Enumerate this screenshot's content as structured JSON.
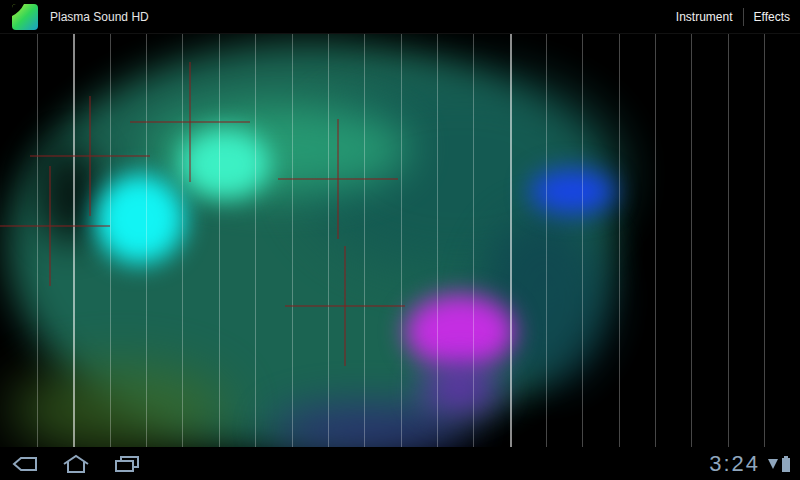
{
  "app": {
    "title": "Plasma Sound HD"
  },
  "actions": [
    {
      "label": "Instrument"
    },
    {
      "label": "Effects"
    }
  ],
  "note_lines": [
    {
      "active": false
    },
    {
      "active": true
    },
    {
      "active": false
    },
    {
      "active": false
    },
    {
      "active": false
    },
    {
      "active": false
    },
    {
      "active": false
    },
    {
      "active": false
    },
    {
      "active": false
    },
    {
      "active": false
    },
    {
      "active": false
    },
    {
      "active": false
    },
    {
      "active": false
    },
    {
      "active": true
    },
    {
      "active": false
    },
    {
      "active": false
    },
    {
      "active": false
    },
    {
      "active": false
    },
    {
      "active": false
    },
    {
      "active": false
    },
    {
      "active": false
    }
  ],
  "status_bar": {
    "time": "3:24"
  }
}
